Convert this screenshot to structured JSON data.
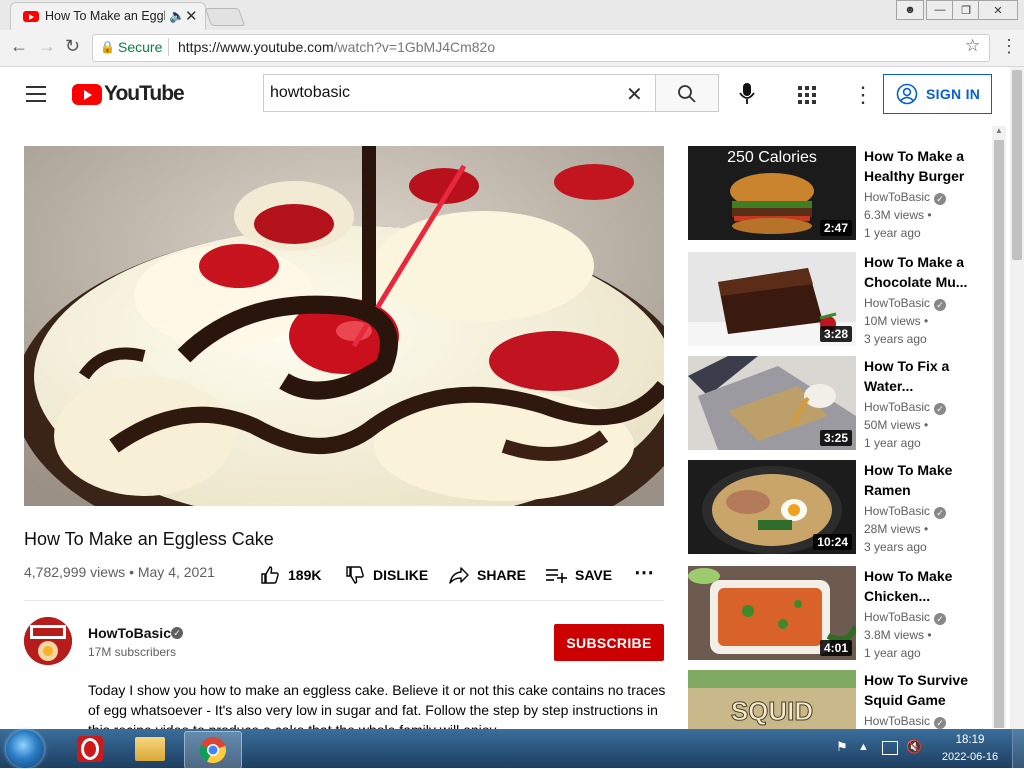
{
  "browser": {
    "tab_title": "How To Make an Eggl",
    "url_label": "Secure",
    "url_main": "https://www.youtube.com",
    "url_path": "/watch?v=1GbMJ4Cm82o"
  },
  "youtube": {
    "logo_text": "YouTube",
    "search_value": "howtobasic",
    "sign_in": "SIGN IN"
  },
  "video": {
    "title": "How To Make an Eggless Cake",
    "meta": "4,782,999 views • May 4, 2021",
    "likes": "189K",
    "dislike": "DISLIKE",
    "share": "SHARE",
    "save": "SAVE",
    "channel": "HowToBasic",
    "subscribers": "17M subscribers",
    "subscribe": "SUBSCRIBE",
    "description": "Today I show you how to make an eggless cake. Believe it or not this cake contains no traces of egg whatsoever - It's also very low in sugar and fat. Follow the step by step instructions in this recipe video to produce a cake that the whole family will enjoy."
  },
  "recommendations": [
    {
      "title": "How To Make a Healthy Burger",
      "channel": "HowToBasic",
      "views": "6.3M views •",
      "age": "1 year ago",
      "duration": "2:47",
      "overlay": "250 Calories"
    },
    {
      "title": "How To Make a Chocolate Mu...",
      "channel": "HowToBasic",
      "views": "10M views •",
      "age": "3 years ago",
      "duration": "3:28"
    },
    {
      "title": "How To Fix a Water...",
      "channel": "HowToBasic",
      "views": "50M views •",
      "age": "1 year ago",
      "duration": "3:25"
    },
    {
      "title": "How To Make Ramen",
      "channel": "HowToBasic",
      "views": "28M views •",
      "age": "3 years ago",
      "duration": "10:24"
    },
    {
      "title": "How To Make Chicken...",
      "channel": "HowToBasic",
      "views": "3.8M views •",
      "age": "1 year ago",
      "duration": "4:01"
    },
    {
      "title": "How To Survive Squid Game",
      "channel": "HowToBasic",
      "overlay": "SQUID"
    }
  ],
  "taskbar": {
    "time": "18:19",
    "date": "2022-06-16"
  },
  "colors": {
    "yt_red": "#ff0000",
    "subscribe_red": "#cc0000",
    "signin_blue": "#065fd4",
    "secure_green": "#0b8043"
  }
}
